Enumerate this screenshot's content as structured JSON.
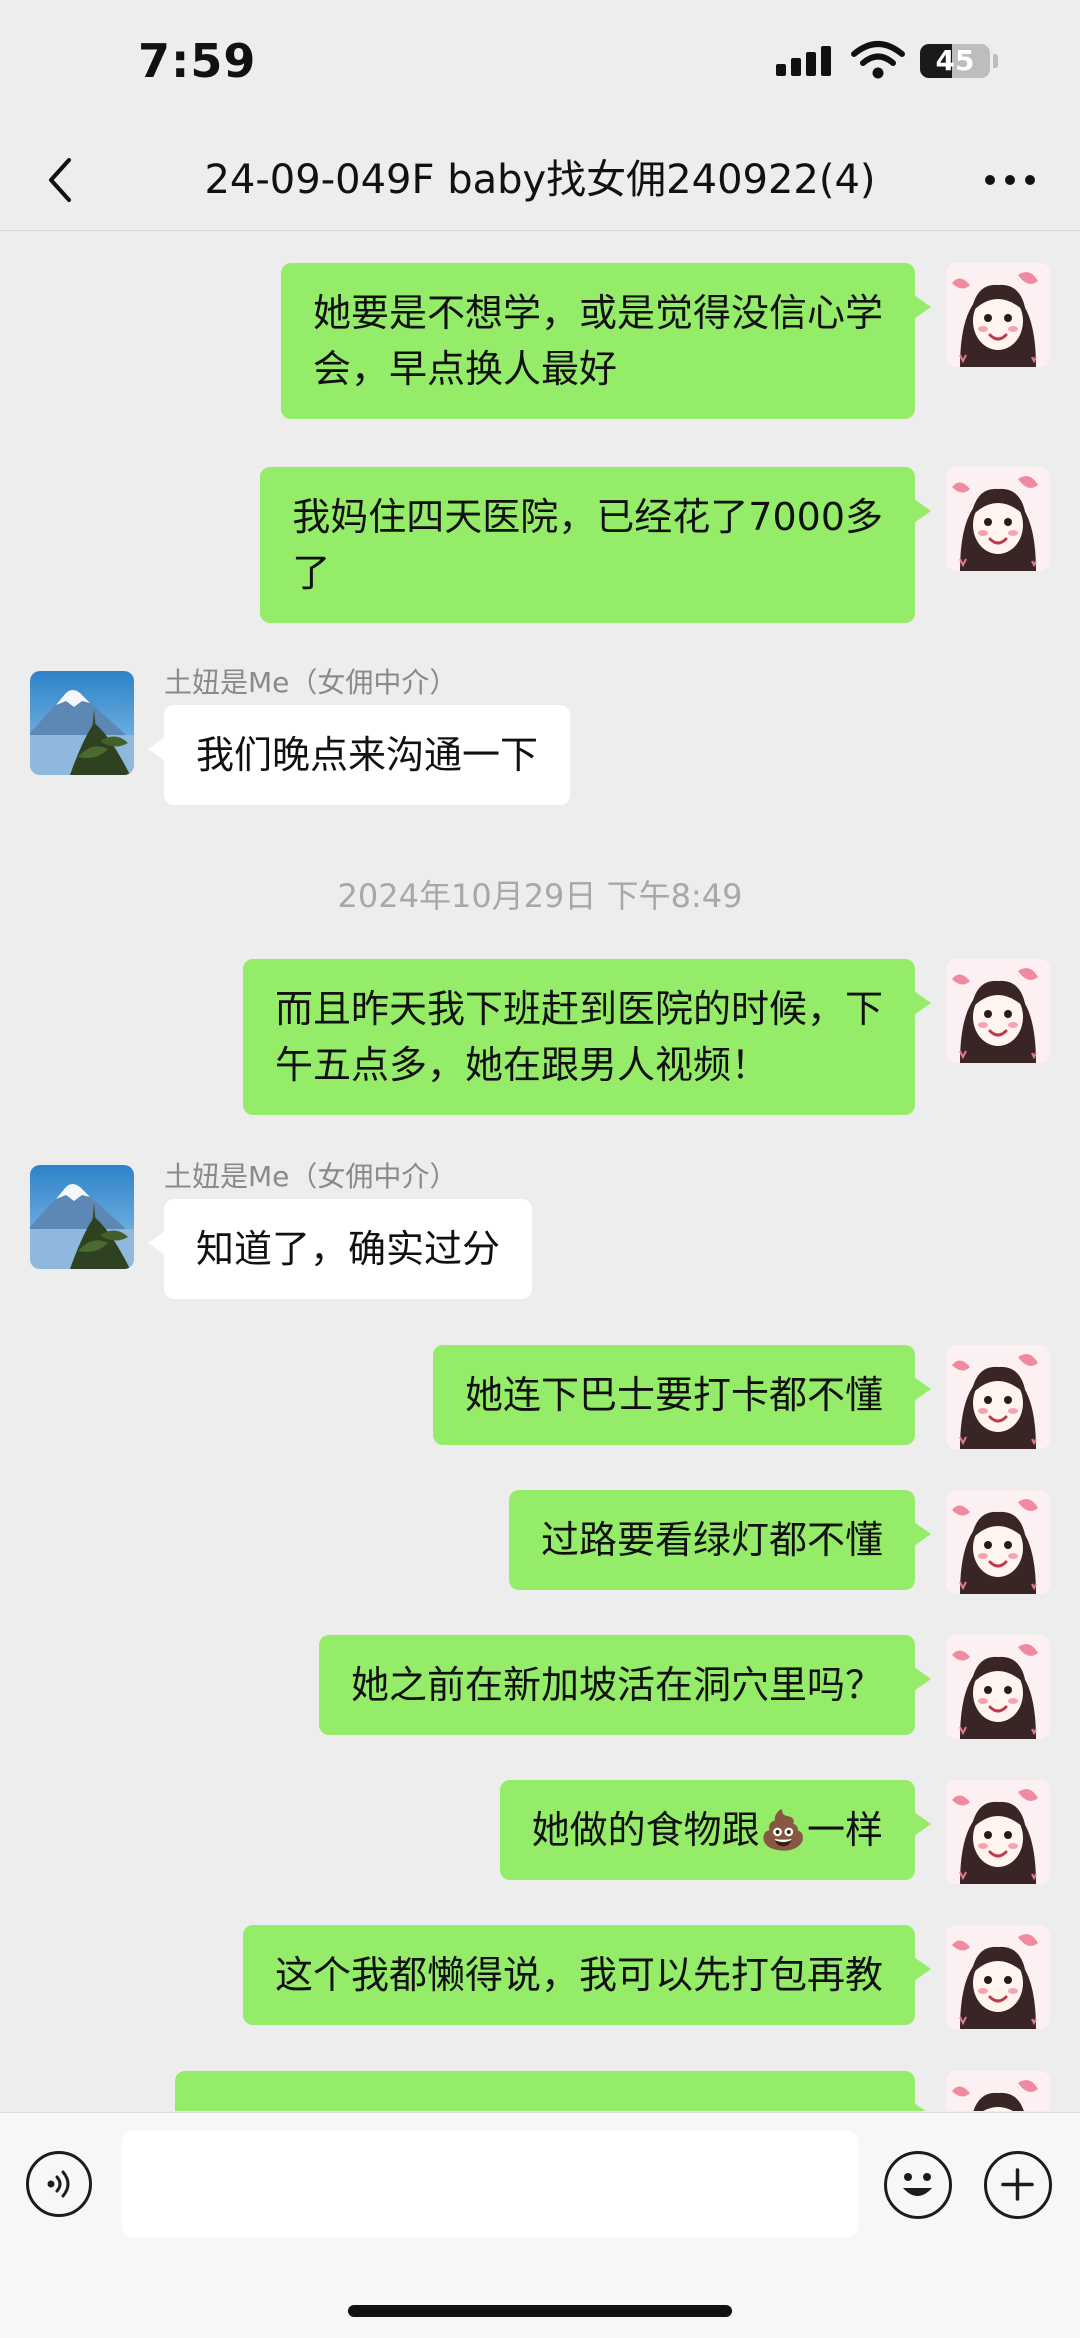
{
  "status_bar": {
    "time": "7:59",
    "battery": "45",
    "battery_level": 0.45
  },
  "nav": {
    "title": "24-09-049F baby找女佣240922(4)"
  },
  "messages": [
    {
      "type": "sent",
      "lines": [
        "她要是不想学，或是觉得没信心学",
        "会，早点换人最好"
      ]
    },
    {
      "type": "sent",
      "lines": [
        "我妈住四天医院，已经花了7000多",
        "了"
      ]
    },
    {
      "type": "recv",
      "sender": "土妞是Me（女佣中介）",
      "text": "我们晚点来沟通一下"
    },
    {
      "type": "time",
      "text": "2024年10月29日 下午8:49"
    },
    {
      "type": "sent",
      "lines": [
        "而且昨天我下班赶到医院的时候，下",
        "午五点多，她在跟男人视频！"
      ]
    },
    {
      "type": "recv",
      "sender": "土妞是Me（女佣中介）",
      "text": "知道了，确实过分"
    },
    {
      "type": "sent",
      "lines": [
        "她连下巴士要打卡都不懂"
      ]
    },
    {
      "type": "sent",
      "lines": [
        "过路要看绿灯都不懂"
      ]
    },
    {
      "type": "sent",
      "lines": [
        "她之前在新加坡活在洞穴里吗？"
      ]
    },
    {
      "type": "sent",
      "text_before": "她做的食物跟",
      "emoji": "💩",
      "text_after": "一样"
    },
    {
      "type": "sent",
      "lines": [
        "这个我都懒得说，我可以先打包再教"
      ]
    }
  ],
  "input": {
    "placeholder": ""
  },
  "icons": {
    "back": "chevron-left-icon",
    "more": "more-dots-icon",
    "voice": "voice-icon",
    "emoji": "emoji-icon",
    "plus": "plus-icon"
  },
  "colors": {
    "sent_bubble": "#95ec69",
    "recv_bubble": "#ffffff",
    "background": "#ededed"
  }
}
